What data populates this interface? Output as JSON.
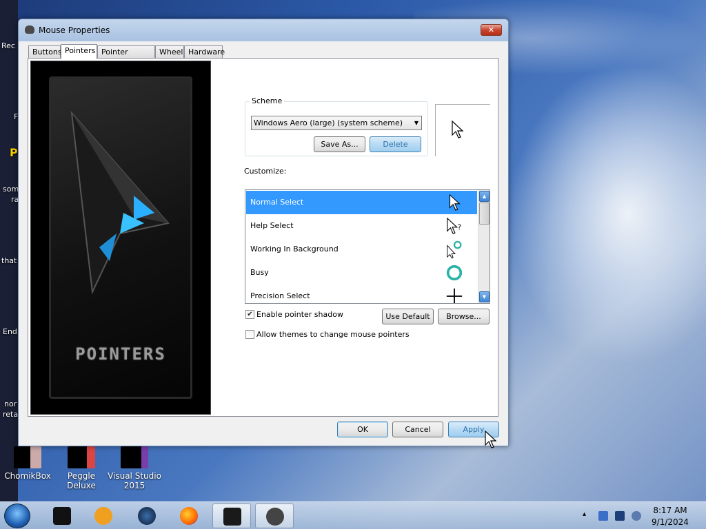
{
  "window": {
    "title": "Mouse Properties",
    "close_glyph": "✕",
    "tabs": [
      {
        "label": "Buttons"
      },
      {
        "label": "Pointers"
      },
      {
        "label": "Pointer Options"
      },
      {
        "label": "Wheel"
      },
      {
        "label": "Hardware"
      }
    ],
    "active_tab": "Pointers",
    "art_label": "POINTERS"
  },
  "scheme": {
    "legend": "Scheme",
    "selected": "Windows Aero (large) (system scheme)",
    "save_as": "Save As...",
    "delete": "Delete"
  },
  "customize": {
    "label": "Customize:",
    "items": [
      {
        "label": "Normal Select",
        "icon": "arrow-cursor-icon",
        "glyph": "➤",
        "selected": true
      },
      {
        "label": "Help Select",
        "icon": "help-cursor-icon",
        "glyph": "➤?",
        "selected": false
      },
      {
        "label": "Working In Background",
        "icon": "working-cursor-icon",
        "glyph": "➤◯",
        "selected": false
      },
      {
        "label": "Busy",
        "icon": "busy-ring-icon",
        "glyph": "◯",
        "selected": false
      },
      {
        "label": "Precision Select",
        "icon": "crosshair-icon",
        "glyph": "+",
        "selected": false
      }
    ]
  },
  "options": {
    "enable_shadow": {
      "label": "Enable pointer shadow",
      "checked": true
    },
    "allow_themes": {
      "label": "Allow themes to change mouse pointers",
      "checked": false
    },
    "use_default": "Use Default",
    "browse": "Browse..."
  },
  "footer": {
    "ok": "OK",
    "cancel": "Cancel",
    "apply": "Apply"
  },
  "desktop": {
    "side_texts": [
      "Rec",
      "F",
      "P",
      "som",
      "ra",
      "that",
      "End",
      "nor",
      "reta"
    ],
    "icons": [
      {
        "label": "ChomikBox"
      },
      {
        "label": "Peggle Deluxe"
      },
      {
        "label": "Visual Studio 2015"
      }
    ]
  },
  "taskbar": {
    "time": "8:17 AM",
    "date": "9/1/2024",
    "show_hidden": "▴"
  }
}
